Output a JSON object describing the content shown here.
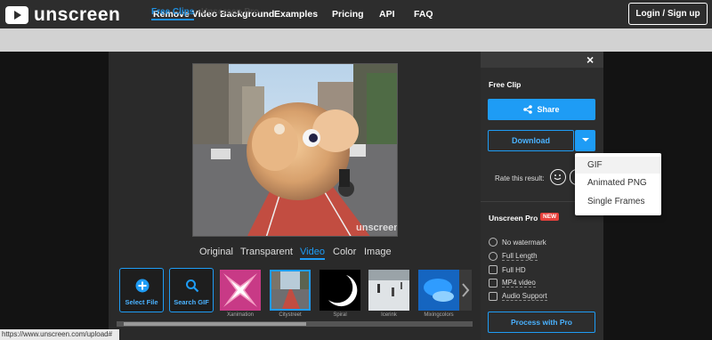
{
  "header": {
    "brand": "unscreen",
    "nav": [
      "Remove Video Background",
      "Examples",
      "Pricing",
      "API",
      "FAQ"
    ],
    "login": "Login / Sign up"
  },
  "subnav": {
    "tabs": [
      "Free Clips",
      "Unscreen Pro"
    ],
    "active": "Free Clips"
  },
  "preview": {
    "watermark": "unscreen"
  },
  "view_tabs": {
    "items": [
      "Original",
      "Transparent",
      "Video",
      "Color",
      "Image"
    ],
    "active": "Video"
  },
  "tools": {
    "select_file": "Select File",
    "search_gif": "Search GIF"
  },
  "backgrounds": [
    "Xanimation",
    "Citystreet",
    "Spiral",
    "Icerink",
    "Mixingcolors"
  ],
  "status_url": "https://www.unscreen.com/upload#",
  "panel": {
    "title": "Free Clip",
    "share": "Share",
    "download": "Download",
    "rate_label": "Rate this result:",
    "download_options": [
      "GIF",
      "Animated PNG",
      "Single Frames"
    ],
    "pro_title": "Unscreen Pro",
    "pro_badge": "NEW",
    "pro_features": [
      "No watermark",
      "Full Length",
      "Full HD",
      "MP4 video",
      "Audio Support"
    ],
    "pro_button": "Process with Pro",
    "close": "×"
  },
  "colors": {
    "accent": "#1e9cf5",
    "badge": "#e8413c"
  }
}
